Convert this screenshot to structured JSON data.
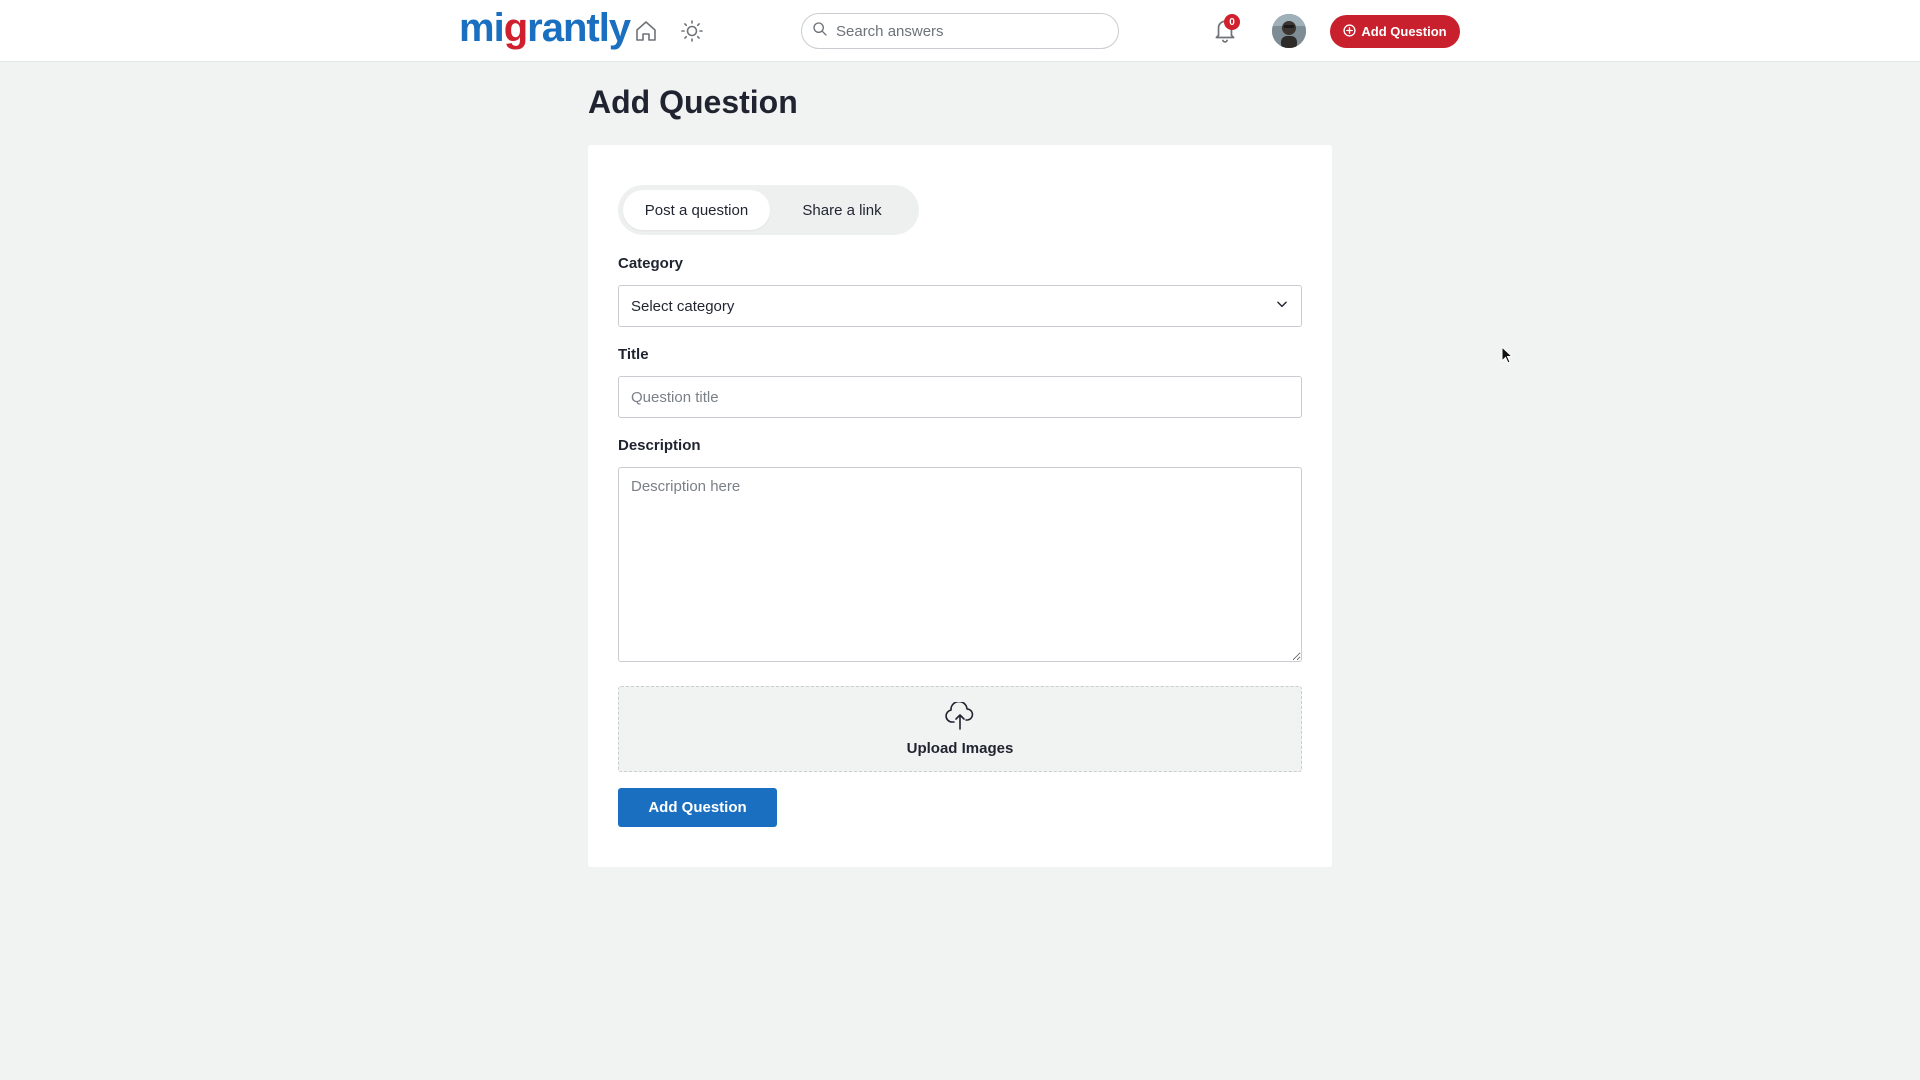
{
  "brand": {
    "logo_part1": "mi",
    "logo_part2": "g",
    "logo_part3": "rantly"
  },
  "header": {
    "search_placeholder": "Search answers",
    "notification_count": "0",
    "add_question_label": "Add Question"
  },
  "page": {
    "title": "Add Question"
  },
  "tabs": [
    {
      "label": "Post a question",
      "active": true
    },
    {
      "label": "Share a link",
      "active": false
    }
  ],
  "form": {
    "category_label": "Category",
    "category_value": "Select category",
    "title_label": "Title",
    "title_placeholder": "Question title",
    "description_label": "Description",
    "description_placeholder": "Description here",
    "upload_label": "Upload Images",
    "submit_label": "Add Question"
  },
  "colors": {
    "brand_blue": "#1a6fc1",
    "brand_red": "#c8202c",
    "background": "#f1f2f2"
  },
  "icons": [
    "home-icon",
    "sun-icon",
    "search-icon",
    "bell-icon",
    "plus-circle-icon",
    "chevron-down-icon",
    "cloud-upload-icon"
  ]
}
